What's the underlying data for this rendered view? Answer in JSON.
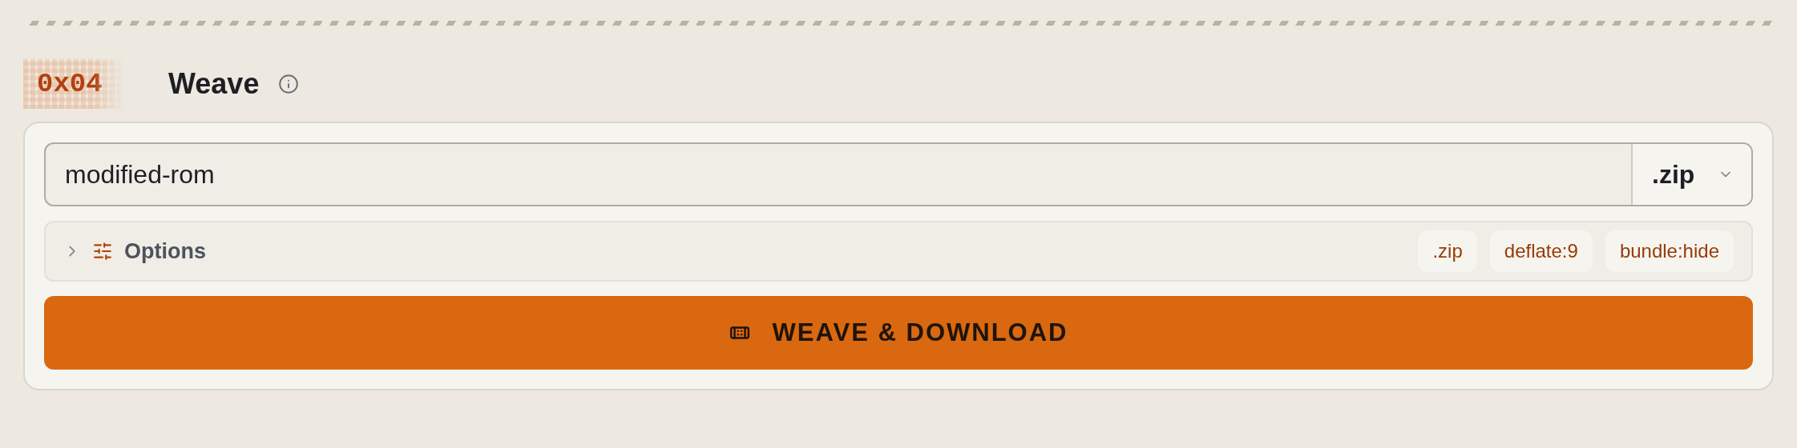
{
  "section": {
    "badge": "0x04",
    "title": "Weave"
  },
  "filename": {
    "value": "modified-rom",
    "extension": ".zip"
  },
  "options": {
    "label": "Options",
    "expanded": false,
    "tags": [
      ".zip",
      "deflate:9",
      "bundle:hide"
    ]
  },
  "action": {
    "label": "WEAVE & DOWNLOAD"
  }
}
